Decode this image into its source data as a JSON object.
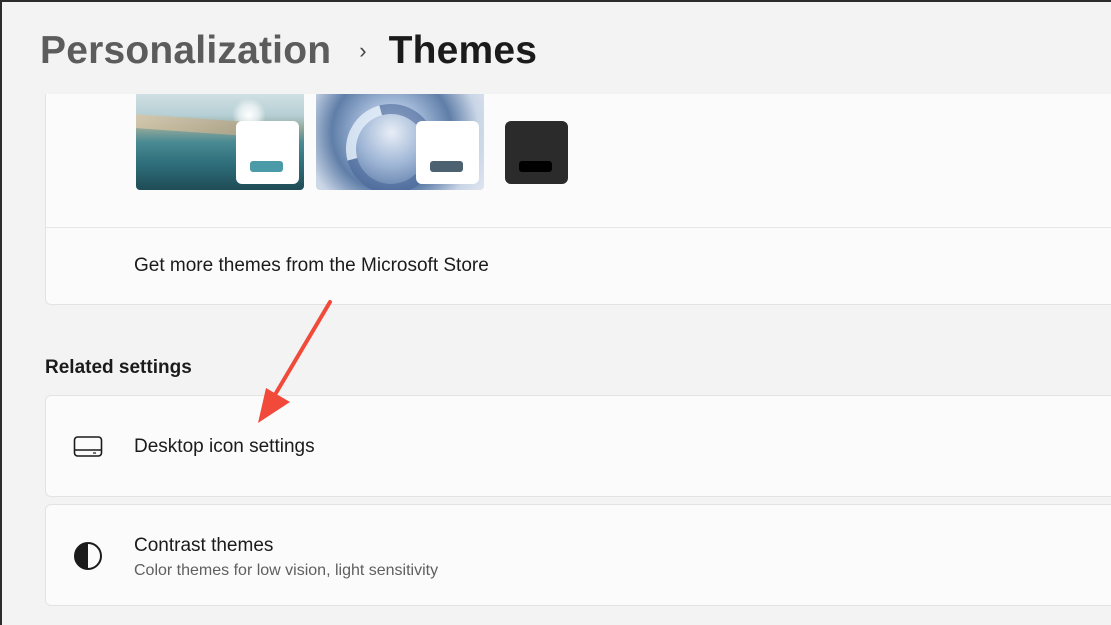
{
  "header": {
    "breadcrumb_parent": "Personalization",
    "breadcrumb_separator": "›",
    "breadcrumb_current": "Themes"
  },
  "themes": {
    "items": [
      {
        "name": "landscape-theme",
        "accent": "#4a9aa8"
      },
      {
        "name": "bloom-theme",
        "accent": "#4d6270"
      },
      {
        "name": "dark-theme",
        "accent": "#000000"
      }
    ],
    "store_link_label": "Get more themes from the Microsoft Store"
  },
  "related_settings": {
    "heading": "Related settings",
    "items": [
      {
        "title": "Desktop icon settings",
        "icon": "desktop-icon",
        "subtitle": ""
      },
      {
        "title": "Contrast themes",
        "icon": "contrast-icon",
        "subtitle": "Color themes for low vision, light sensitivity"
      }
    ]
  },
  "annotation": {
    "type": "arrow",
    "color": "#f24a3a"
  },
  "colors": {
    "background": "#f3f3f3",
    "card": "#fbfbfb"
  }
}
